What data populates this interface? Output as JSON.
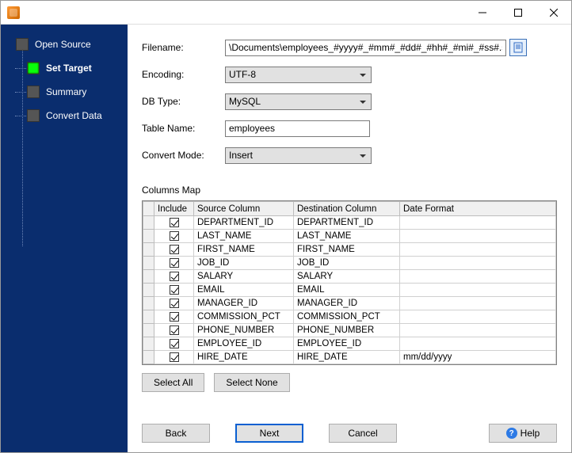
{
  "steps": {
    "open_source": "Open Source",
    "set_target": "Set Target",
    "summary": "Summary",
    "convert_data": "Convert Data"
  },
  "form": {
    "filename_label": "Filename:",
    "filename_value": "\\Documents\\employees_#yyyy#_#mm#_#dd#_#hh#_#mi#_#ss#.sql",
    "encoding_label": "Encoding:",
    "encoding_value": "UTF-8",
    "dbtype_label": "DB Type:",
    "dbtype_value": "MySQL",
    "tablename_label": "Table Name:",
    "tablename_value": "employees",
    "convertmode_label": "Convert Mode:",
    "convertmode_value": "Insert"
  },
  "columns_map_label": "Columns Map",
  "headers": {
    "include": "Include",
    "source": "Source Column",
    "dest": "Destination Column",
    "datefmt": "Date Format"
  },
  "rows": [
    {
      "src": "DEPARTMENT_ID",
      "dst": "DEPARTMENT_ID",
      "fmt": ""
    },
    {
      "src": "LAST_NAME",
      "dst": "LAST_NAME",
      "fmt": ""
    },
    {
      "src": "FIRST_NAME",
      "dst": "FIRST_NAME",
      "fmt": ""
    },
    {
      "src": "JOB_ID",
      "dst": "JOB_ID",
      "fmt": ""
    },
    {
      "src": "SALARY",
      "dst": "SALARY",
      "fmt": ""
    },
    {
      "src": "EMAIL",
      "dst": "EMAIL",
      "fmt": ""
    },
    {
      "src": "MANAGER_ID",
      "dst": "MANAGER_ID",
      "fmt": ""
    },
    {
      "src": "COMMISSION_PCT",
      "dst": "COMMISSION_PCT",
      "fmt": ""
    },
    {
      "src": "PHONE_NUMBER",
      "dst": "PHONE_NUMBER",
      "fmt": ""
    },
    {
      "src": "EMPLOYEE_ID",
      "dst": "EMPLOYEE_ID",
      "fmt": ""
    },
    {
      "src": "HIRE_DATE",
      "dst": "HIRE_DATE",
      "fmt": "mm/dd/yyyy"
    }
  ],
  "buttons": {
    "select_all": "Select All",
    "select_none": "Select None",
    "back": "Back",
    "next": "Next",
    "cancel": "Cancel",
    "help": "Help"
  }
}
